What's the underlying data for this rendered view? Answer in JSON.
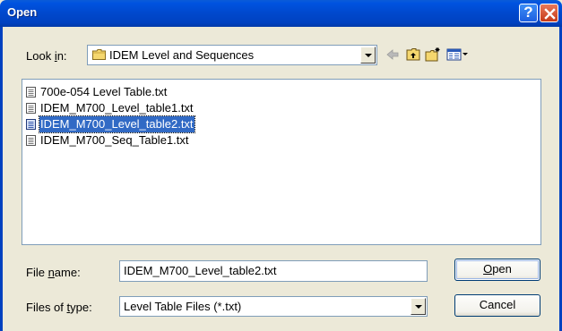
{
  "window": {
    "title": "Open",
    "help_glyph": "?"
  },
  "look_in": {
    "label_pre": "Look ",
    "label_u": "i",
    "label_post": "n:",
    "value": "IDEM Level and Sequences",
    "icons": [
      "folder-icon",
      "back-arrow-icon",
      "up-folder-icon",
      "new-folder-icon",
      "view-menu-icon"
    ]
  },
  "files": [
    {
      "name": "700e-054  Level Table.txt",
      "selected": false
    },
    {
      "name": "IDEM_M700_Level_table1.txt",
      "selected": false
    },
    {
      "name": "IDEM_M700_Level_table2.txt",
      "selected": true
    },
    {
      "name": "IDEM_M700_Seq_Table1.txt",
      "selected": false
    }
  ],
  "file_name": {
    "label_pre": "File ",
    "label_u": "n",
    "label_post": "ame:",
    "value": "IDEM_M700_Level_table2.txt"
  },
  "file_type": {
    "label_pre": "Files of ",
    "label_u": "t",
    "label_post": "ype:",
    "value": "Level Table Files (*.txt)"
  },
  "buttons": {
    "open_u": "O",
    "open_rest": "pen",
    "cancel": "Cancel"
  }
}
